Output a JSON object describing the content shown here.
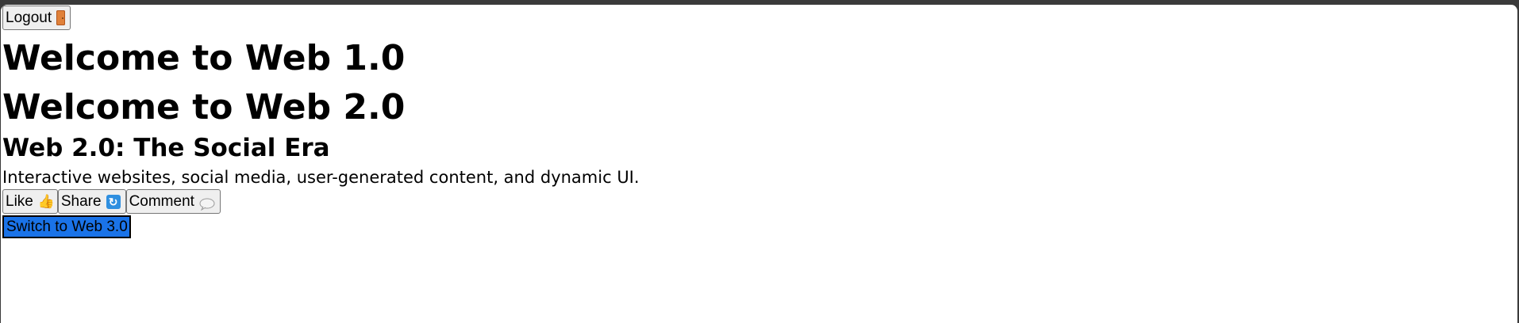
{
  "header": {
    "logout_label": "Logout",
    "logout_icon": "door-icon"
  },
  "main": {
    "title_web1": "Welcome to Web 1.0",
    "title_web2": "Welcome to Web 2.0",
    "subtitle": "Web 2.0: The Social Era",
    "description": "Interactive websites, social media, user-generated content, and dynamic UI."
  },
  "actions": {
    "like_label": "Like",
    "like_icon": "thumbs-up-icon",
    "share_label": "Share",
    "share_icon": "refresh-icon",
    "comment_label": "Comment",
    "comment_icon": "speech-bubble-icon"
  },
  "switch": {
    "label": "Switch to Web 3.0",
    "color": "#1a73e8"
  }
}
